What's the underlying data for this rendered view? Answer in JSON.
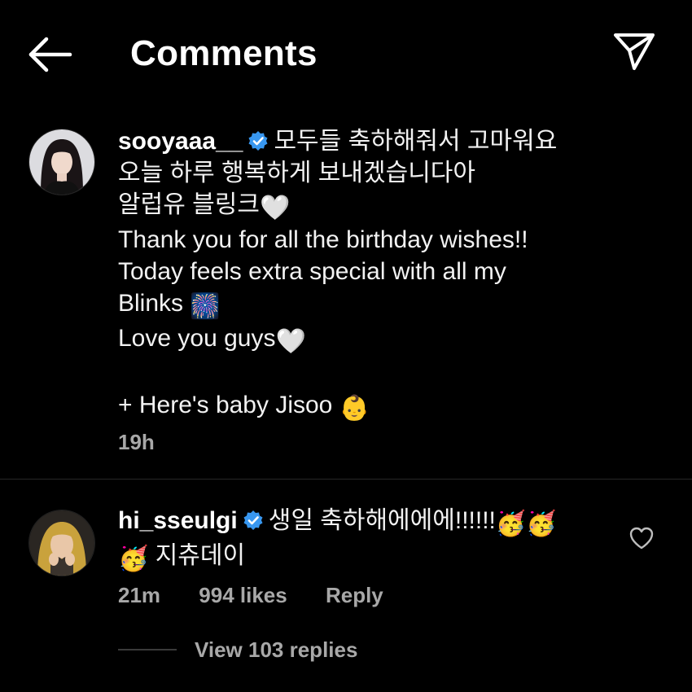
{
  "header": {
    "title": "Comments",
    "back_icon": "arrow-left-icon",
    "send_icon": "paper-plane-icon"
  },
  "caption": {
    "username": "sooyaaa__",
    "verified_icon": "verified-badge-icon",
    "lines": [
      "모두들 축하해줘서 고마워요",
      "오늘 하루 행복하게 보내겠습니다아",
      "알럽유 블링크",
      "Thank you for all the birthday wishes!!",
      "Today feels extra special with all my",
      "Blinks",
      "Love you guys",
      "",
      "+ Here's baby Jisoo"
    ],
    "emoji": {
      "white_heart": "🤍",
      "fireworks": "🎆",
      "baby": "👶"
    },
    "time": "19h"
  },
  "reply": {
    "username": "hi_sseulgi",
    "verified_icon": "verified-badge-icon",
    "line1": "생일 축하해에에에!!!!!!",
    "line2": "지츄데이",
    "emoji": {
      "party_face": "🥳"
    },
    "time": "21m",
    "likes": "994 likes",
    "reply_label": "Reply",
    "like_icon": "heart-outline-icon"
  },
  "view_replies": {
    "label": "View 103 replies"
  },
  "colors": {
    "background": "#000000",
    "text": "#f2f2f2",
    "secondary_text": "#a8a8a8",
    "verified_blue": "#3897f0",
    "divider": "#262626"
  }
}
